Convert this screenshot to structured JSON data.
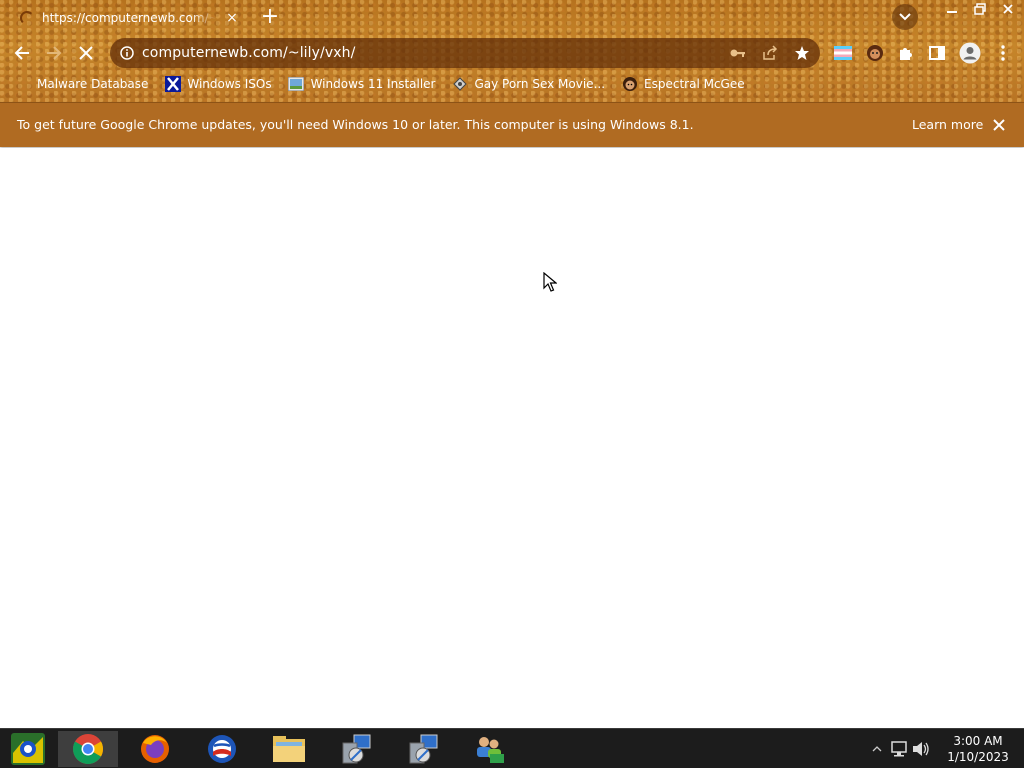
{
  "tab": {
    "title": "https://computernewb.com/~lily/vxh/",
    "close": "×"
  },
  "new_tab_label": "+",
  "address_bar": {
    "url": "computernewb.com/~lily/vxh/"
  },
  "bookmarks": [
    {
      "label": "Malware Database",
      "icon": "bookmark-icon"
    },
    {
      "label": "Windows ISOs",
      "icon": "x-logo-icon"
    },
    {
      "label": "Windows 11 Installer",
      "icon": "image-icon"
    },
    {
      "label": "Gay Porn Sex Movie...",
      "icon": "disk-icon"
    },
    {
      "label": "Espectral McGee",
      "icon": "face-icon"
    }
  ],
  "infobar": {
    "message": "To get future Google Chrome updates, you'll need Windows 10 or later. This computer is using Windows 8.1.",
    "learn_more": "Learn more"
  },
  "taskbar": {
    "apps": [
      "start-button",
      "chrome",
      "firefox",
      "opera",
      "file-explorer",
      "installer",
      "installer",
      "network-users"
    ],
    "active_app": "chrome"
  },
  "clock": {
    "time": "3:00 AM",
    "date": "1/10/2023"
  },
  "colors": {
    "accent": "#b06b22",
    "frame": "#c6862a",
    "taskbar": "#1c1c1c"
  }
}
